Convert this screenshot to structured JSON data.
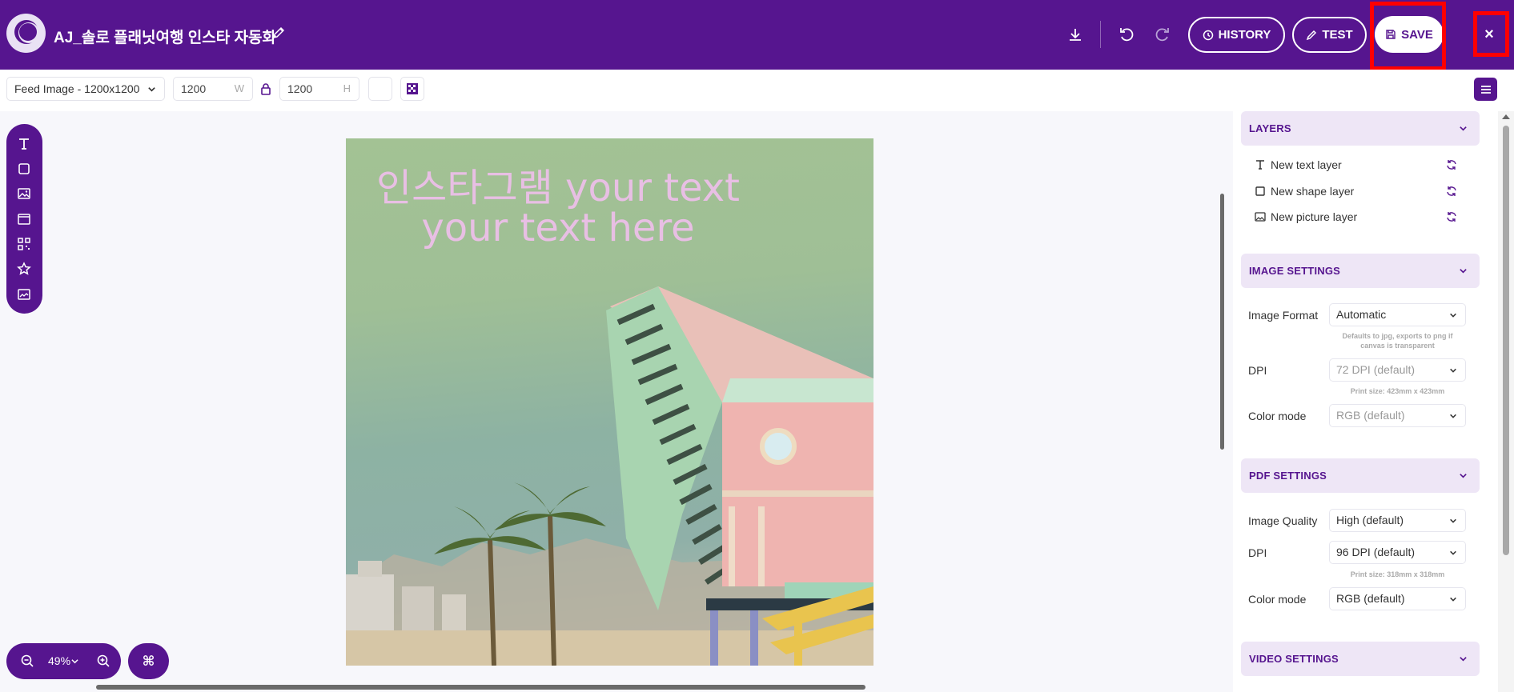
{
  "header": {
    "title": "AJ_솔로 플래닛여행 인스타 자동화",
    "history_label": "HISTORY",
    "test_label": "TEST",
    "save_label": "SAVE",
    "close_label": "×"
  },
  "toolbar": {
    "format_value": "Feed Image - 1200x1200",
    "width_value": "1200",
    "width_unit": "W",
    "height_value": "1200",
    "height_unit": "H"
  },
  "canvas": {
    "text_line1": "인스타그램 your text",
    "text_line2": "your text here",
    "text_color": "#e8bfe4"
  },
  "zoom": {
    "value": "49%",
    "command_glyph": "⌘"
  },
  "panel": {
    "layers": {
      "title": "LAYERS",
      "items": [
        {
          "label": "New text layer",
          "icon": "text-icon"
        },
        {
          "label": "New shape layer",
          "icon": "square-icon"
        },
        {
          "label": "New picture layer",
          "icon": "image-icon"
        }
      ]
    },
    "image_settings": {
      "title": "IMAGE SETTINGS",
      "format_label": "Image Format",
      "format_value": "Automatic",
      "format_hint": "Defaults to jpg, exports to png if canvas is transparent",
      "dpi_label": "DPI",
      "dpi_value": "72 DPI (default)",
      "dpi_hint": "Print size: 423mm x 423mm",
      "color_label": "Color mode",
      "color_value": "RGB (default)"
    },
    "pdf_settings": {
      "title": "PDF SETTINGS",
      "quality_label": "Image Quality",
      "quality_value": "High (default)",
      "dpi_label": "DPI",
      "dpi_value": "96 DPI (default)",
      "dpi_hint": "Print size: 318mm x 318mm",
      "color_label": "Color mode",
      "color_value": "RGB (default)"
    },
    "video_settings": {
      "title": "VIDEO SETTINGS"
    }
  },
  "colors": {
    "brand": "#56158f",
    "highlight": "#ff0000"
  }
}
